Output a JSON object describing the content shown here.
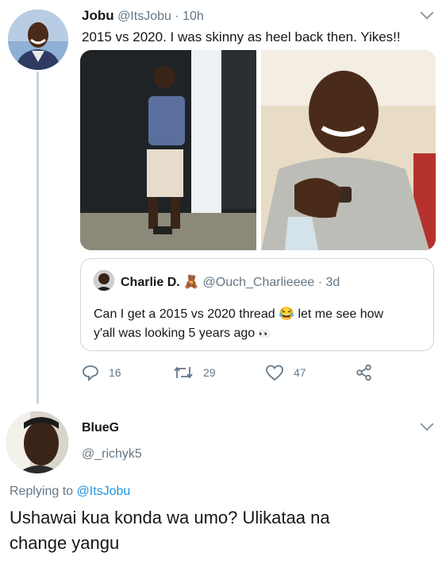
{
  "tweet": {
    "author_name": "Jobu",
    "author_handle": "@ItsJobu",
    "time": "· 10h",
    "text": "2015 vs 2020. I was skinny as heel back then. Yikes!!"
  },
  "quote": {
    "author_name": "Charlie D.",
    "badge": "🧸",
    "author_handle": "@Ouch_Charlieeee",
    "time": "· 3d",
    "text_line1": "Can I get a 2015 vs 2020 thread",
    "emoji": "😂",
    "text_line1b": "let me see how",
    "text_line2": "y'all was looking 5 years ago",
    "text_line2_emoji": "👀"
  },
  "actions": {
    "replies": "16",
    "retweets": "29",
    "likes": "47"
  },
  "reply": {
    "author_name": "BlueG",
    "author_handle": "@_richyk5",
    "replying_prefix": "Replying to",
    "replying_handle": "@ItsJobu",
    "line1": "Ushawai kua konda wa umo? Ulikataa na",
    "line2": "change yangu"
  },
  "colors": {
    "accent": "#1b95e0",
    "muted": "#657786",
    "thread_line": "#c5d2db"
  },
  "icons": [
    "reply-icon",
    "retweet-icon",
    "like-icon",
    "share-icon",
    "chevron-down-icon"
  ]
}
